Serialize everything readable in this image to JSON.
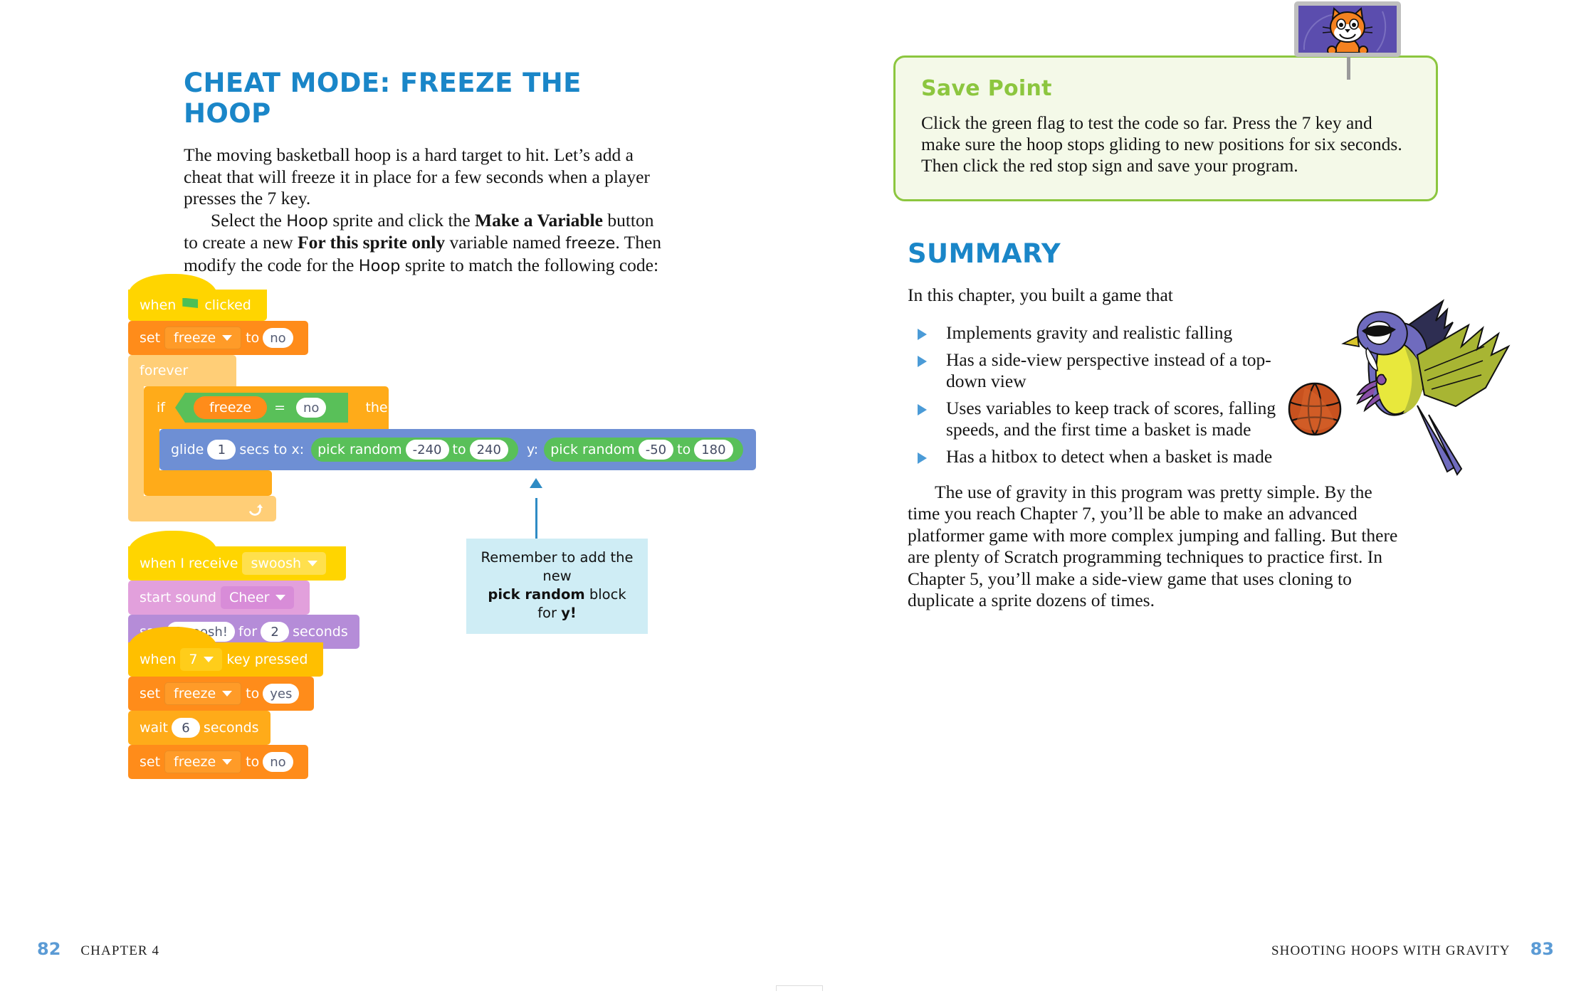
{
  "left_page": {
    "heading": "Cheat Mode: Freeze the Hoop",
    "para1": "The moving basketball hoop is a hard target to hit. Let’s add a cheat that will freeze it in place for a few seconds when a player presses the 7 key.",
    "para2_parts": {
      "t1": "Select the ",
      "code1": "Hoop",
      "t2": " sprite and click the ",
      "bold1": "Make a Variable",
      "t3": " button to create a new ",
      "bold2": "For this sprite only",
      "t4": " variable named ",
      "code2": "freeze",
      "t5": ". Then modify the code for the ",
      "code3": "Hoop",
      "t6": " sprite to match the following code:"
    },
    "callout": {
      "line1": "Remember to add the new",
      "line2_bold": "pick random",
      "line2_mid": " block for ",
      "line2_bold2": "y!"
    }
  },
  "scripts": {
    "script1": {
      "hat": {
        "when": "when",
        "icon": "green-flag-icon",
        "clicked": "clicked"
      },
      "set1": {
        "set": "set",
        "variable": "freeze",
        "to": "to",
        "value": "no"
      },
      "forever": "forever",
      "if": {
        "if": "if",
        "var": "freeze",
        "op": "=",
        "value": "no",
        "then": "then"
      },
      "glide": {
        "glide": "glide",
        "secs": "1",
        "secs_to_x": "secs to x:",
        "pick_random_x": "pick random",
        "x_from": "-240",
        "x_to_label": "to",
        "x_to": "240",
        "y_label": "y:",
        "pick_random_y": "pick random",
        "y_from": "-50",
        "y_to_label": "to",
        "y_to": "180"
      },
      "loop_arrow": "loop-arrow-icon"
    },
    "script2": {
      "hat": {
        "when_i_receive": "when I receive",
        "message": "swoosh"
      },
      "start_sound": {
        "label": "start sound",
        "sound": "Cheer"
      },
      "say": {
        "say": "say",
        "text": "Swoosh!",
        "for": "for",
        "secs": "2",
        "seconds": "seconds"
      }
    },
    "script3": {
      "hat": {
        "when": "when",
        "key": "7",
        "key_pressed": "key pressed"
      },
      "set1": {
        "set": "set",
        "variable": "freeze",
        "to": "to",
        "value": "yes"
      },
      "wait": {
        "wait": "wait",
        "secs": "6",
        "seconds": "seconds"
      },
      "set2": {
        "set": "set",
        "variable": "freeze",
        "to": "to",
        "value": "no"
      }
    }
  },
  "right_page": {
    "save_point": {
      "title": "Save Point",
      "body": "Click the green flag to test the code so far. Press the 7 key and make sure the hoop stops gliding to new positions for six seconds. Then click the red stop sign and save your program."
    },
    "summary": {
      "heading": "Summary",
      "intro": "In this chapter, you built a game that",
      "bullets": [
        "Implements gravity and realistic falling",
        "Has a side-view perspective instead of a top-down view",
        "Uses variables to keep track of scores, falling speeds, and the first time a basket is made",
        "Has a hitbox to detect when a basket is made"
      ],
      "closing": "The use of gravity in this program was pretty simple. By the time you reach Chapter 7, you’ll be able to make an advanced platformer game with more complex jumping and falling. But there are plenty of Scratch programming techniques to practice first. In Chapter 5, you’ll make a side-view game that uses cloning to duplicate a sprite dozens of times."
    }
  },
  "footers": {
    "left_folio": "82",
    "left_runhead": "Chapter 4",
    "right_runhead": "Shooting Hoops with Gravity",
    "right_folio": "83"
  },
  "colors": {
    "accent_blue": "#1a86c8",
    "folio_blue": "#5B9BD5",
    "savepoint_green": "#8CC63F",
    "savepoint_bg": "#F4F9E8",
    "callout_bg": "#CFEDF5",
    "arrow_blue": "#2E8BC4"
  }
}
